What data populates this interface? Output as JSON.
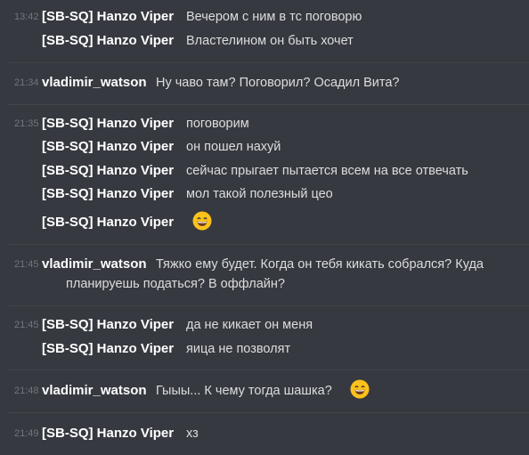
{
  "groups": [
    {
      "time": "13:42",
      "lines": [
        {
          "author": "[SB-SQ] Hanzo Viper",
          "text": "Вечером с ним в тс поговорю"
        },
        {
          "author": "[SB-SQ] Hanzo Viper",
          "text": "Властелином он быть хочет"
        }
      ]
    },
    {
      "time": "21:34",
      "lines": [
        {
          "author": "vladimir_watson",
          "text": "Ну чаво там? Поговорил? Осадил Вита?"
        }
      ]
    },
    {
      "time": "21:35",
      "lines": [
        {
          "author": "[SB-SQ] Hanzo Viper",
          "text": "поговорим"
        },
        {
          "author": "[SB-SQ] Hanzo Viper",
          "text": "он пошел нахуй"
        },
        {
          "author": "[SB-SQ] Hanzo Viper",
          "text": "сейчас прыгает пытается всем на все отвечать"
        },
        {
          "author": "[SB-SQ] Hanzo Viper",
          "text": "мол такой полезный цео"
        },
        {
          "author": "[SB-SQ] Hanzo Viper",
          "text": "",
          "emoji": "grinning-face-icon"
        }
      ]
    },
    {
      "time": "21:45",
      "lines": [
        {
          "author": "vladimir_watson",
          "text": "Тяжко ему будет. Когда он тебя кикать собрался? Куда",
          "text2": "планируешь податься? В оффлайн?"
        }
      ]
    },
    {
      "time": "21:45",
      "lines": [
        {
          "author": "[SB-SQ] Hanzo Viper",
          "text": "да не кикает он меня"
        },
        {
          "author": "[SB-SQ] Hanzo Viper",
          "text": "яица не позволят"
        }
      ]
    },
    {
      "time": "21:48",
      "lines": [
        {
          "author": "vladimir_watson",
          "text": "Гыыы... К чему тогда шашка?",
          "emoji": "grinning-face-icon"
        }
      ]
    },
    {
      "time": "21:49",
      "lines": [
        {
          "author": "[SB-SQ] Hanzo Viper",
          "text": "хз"
        }
      ]
    }
  ],
  "colors": {
    "background": "#36393f",
    "author": "#ffffff",
    "text": "#dcddde",
    "timestamp": "#72767d",
    "divider": "#42454a",
    "emoji": "#fcc21b"
  }
}
